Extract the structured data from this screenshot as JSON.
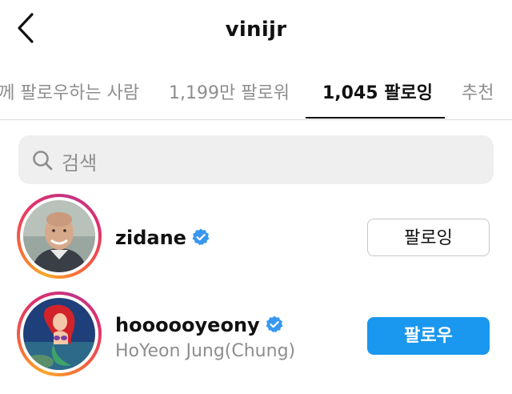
{
  "header": {
    "title": "vinijr",
    "back_icon": "chevron-left-icon"
  },
  "tabs": [
    {
      "label": "함께 팔로우하는 사람",
      "active": false
    },
    {
      "label": "1,199만 팔로워",
      "active": false
    },
    {
      "label": "1,045 팔로잉",
      "active": true
    },
    {
      "label": "추천",
      "active": false
    }
  ],
  "search": {
    "placeholder": "검색",
    "icon": "search-icon"
  },
  "list": [
    {
      "username": "zidane",
      "full_name": "",
      "verified": true,
      "button_label": "팔로잉",
      "button_style": "outline"
    },
    {
      "username": "hoooooyeony",
      "full_name": "HoYeon Jung(Chung)",
      "verified": true,
      "button_label": "팔로우",
      "button_style": "primary"
    }
  ],
  "colors": {
    "primary_button": "#1a97ef",
    "verified_badge": "#3897f0",
    "muted_text": "#8e8e8e",
    "search_bg": "#efefef"
  }
}
